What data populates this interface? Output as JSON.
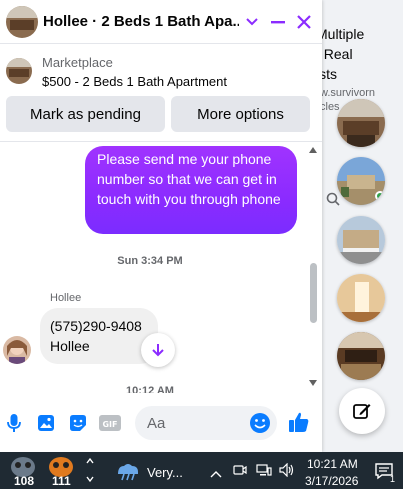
{
  "chat": {
    "title": "Hollee · 2 Beds 1 Bath Apa...",
    "marketplace_label": "Marketplace",
    "listing": "$500 - 2 Beds 1 Bath Apartment",
    "mark_pending_label": "Mark as pending",
    "more_options_label": "More options",
    "outgoing_message": "Please send me your phone number so that we can get in touch with you through phone",
    "timestamp_1": "Sun 3:34 PM",
    "sender_name": "Hollee",
    "incoming_message_line1": "(575)290-9408",
    "incoming_message_line2": "Hollee",
    "timestamp_2": "10:12 AM",
    "input_placeholder": "Aa"
  },
  "background": {
    "title_line1": "Multiple",
    "title_line2": ": Real",
    "title_line3": "ists",
    "url_line1": "w.survivorn",
    "url_line2": "cles"
  },
  "taskbar": {
    "app1_badge": "108",
    "app2_badge": "111",
    "weather_text": "Very...",
    "time": "10:21 AM",
    "date": "3/17/2026",
    "notification_count": "1"
  },
  "colors": {
    "messenger_gradient_start": "#a033ff",
    "messenger_gradient_end": "#7b2cff",
    "accent_blue": "#0a7cff",
    "taskbar_bg": "#1f2a33"
  }
}
